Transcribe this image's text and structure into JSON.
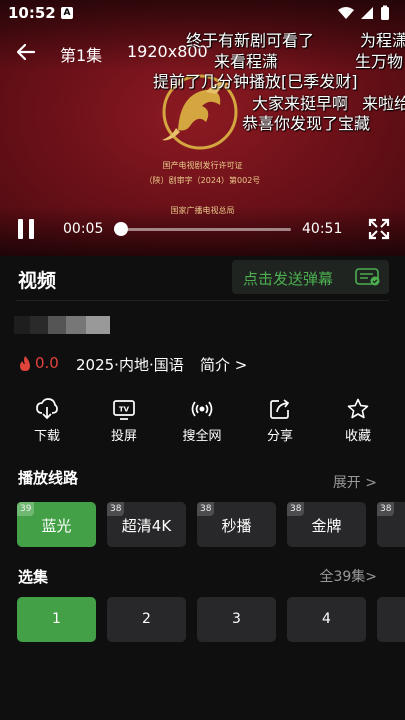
{
  "status_bar": {
    "time": "10:52",
    "notification_icon_letter": "A"
  },
  "player": {
    "episode_title": "第1集",
    "resolution": "1920x800",
    "license_lines": [
      "国产电视剧发行许可证",
      "（陕）剧审字（2024）第002号",
      "国家广播电视总局"
    ],
    "danmaku": [
      "终于有新剧可看了",
      "为程潇",
      "来看程潇",
      "生万物",
      "提前了几分钟播放[巳季发财]",
      "大家来挺早啊",
      "来啦给",
      "恭喜你发现了宝藏"
    ],
    "current_time": "00:05",
    "total_time": "40:51",
    "progress_fraction": 0.002
  },
  "info": {
    "section_title": "视频",
    "danmaku_button_label": "点击发送弹幕",
    "score": "0.0",
    "meta": "2025·内地·国语",
    "intro_link": "简介 >"
  },
  "actions": [
    {
      "label": "下载",
      "icon": "download-icon"
    },
    {
      "label": "投屏",
      "icon": "tv-cast-icon"
    },
    {
      "label": "搜全网",
      "icon": "broadcast-icon"
    },
    {
      "label": "分享",
      "icon": "share-icon"
    },
    {
      "label": "收藏",
      "icon": "star-icon"
    }
  ],
  "lines": {
    "title": "播放线路",
    "more": "展开 >",
    "items": [
      {
        "label": "蓝光",
        "badge": "39",
        "active": true
      },
      {
        "label": "超清4K",
        "badge": "38",
        "active": false
      },
      {
        "label": "秒播",
        "badge": "38",
        "active": false
      },
      {
        "label": "金牌",
        "badge": "38",
        "active": false
      },
      {
        "label": "",
        "badge": "38",
        "active": false
      }
    ]
  },
  "episodes": {
    "title": "选集",
    "more": "全39集>",
    "items": [
      "1",
      "2",
      "3",
      "4",
      ""
    ]
  },
  "colors": {
    "accent_green": "#43a047",
    "score_red": "#e0443b",
    "emblem_gold": "#d4a640"
  }
}
